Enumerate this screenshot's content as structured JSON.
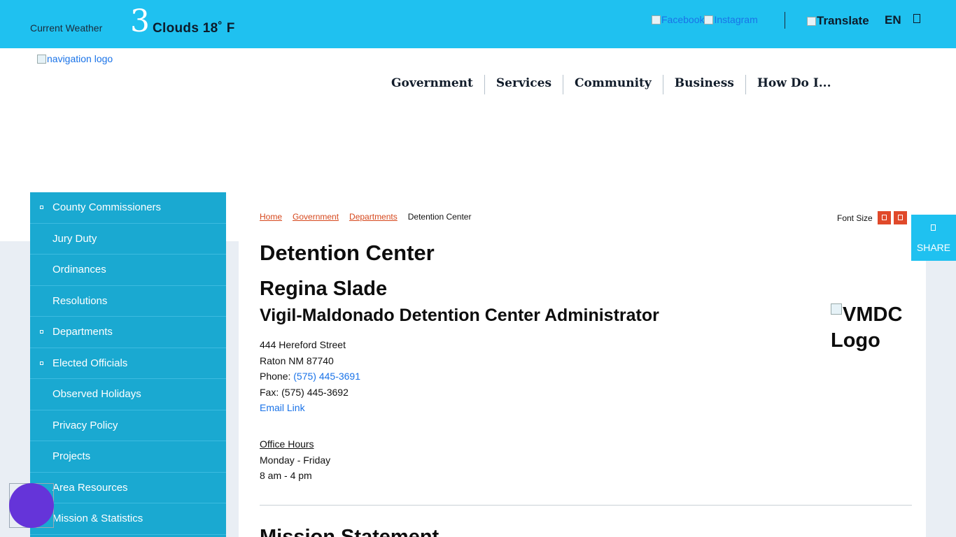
{
  "topbar": {
    "weather_label": "Current Weather",
    "weather_icon": "3",
    "weather_condition": "Clouds 18˚ F",
    "social": [
      "Facebook",
      "Instagram"
    ],
    "translate_label": "Translate",
    "language": "EN"
  },
  "header": {
    "logo_alt": "navigation logo",
    "nav": [
      "Government",
      "Services",
      "Community",
      "Business",
      "How Do I..."
    ]
  },
  "sidebar": {
    "items": [
      {
        "label": "County Commissioners",
        "expandable": true
      },
      {
        "label": "Jury Duty",
        "expandable": false
      },
      {
        "label": "Ordinances",
        "expandable": false
      },
      {
        "label": "Resolutions",
        "expandable": false
      },
      {
        "label": "Departments",
        "expandable": true
      },
      {
        "label": "Elected Officials",
        "expandable": true
      },
      {
        "label": "Observed Holidays",
        "expandable": false
      },
      {
        "label": "Privacy Policy",
        "expandable": false
      },
      {
        "label": "Projects",
        "expandable": false
      },
      {
        "label": "Area Resources",
        "expandable": false
      },
      {
        "label": "Mission & Statistics",
        "expandable": false
      }
    ]
  },
  "breadcrumb": {
    "links": [
      "Home",
      "Government",
      "Departments"
    ],
    "current": "Detention Center"
  },
  "font_size_label": "Font Size",
  "share_label": "SHARE",
  "main": {
    "title": "Detention Center",
    "name": "Regina Slade",
    "role": "Vigil-Maldonado Detention Center Administrator",
    "address_line1": "444 Hereford Street",
    "address_line2": "Raton NM 87740",
    "phone_label": "Phone: ",
    "phone": "(575) 445-3691",
    "fax": "Fax: (575) 445-3692",
    "email_link": "Email Link",
    "hours_label": "Office Hours",
    "hours_days": "Monday - Friday",
    "hours_time": "8 am - 4 pm",
    "logo_alt": "VMDC Logo",
    "next_heading": "Mission Statement"
  },
  "colors": {
    "topbar": "#1fc1f0",
    "sidebar": "#1aa9d1",
    "breadcrumb_link": "#d6471c",
    "link": "#1a73e8",
    "accessibility_button": "#6534d9"
  }
}
